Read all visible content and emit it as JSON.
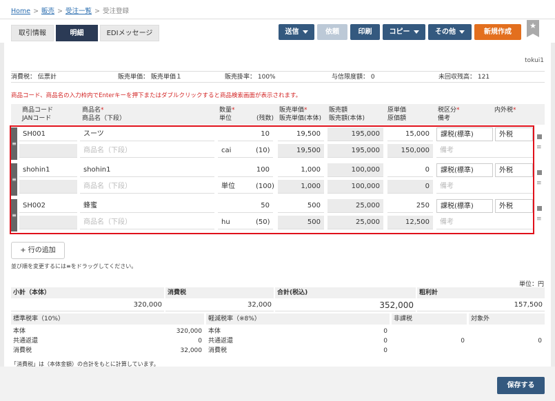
{
  "breadcrumb": {
    "home": "Home",
    "sales": "販売",
    "orders": "受注一覧",
    "current": "受注登録"
  },
  "tabs": [
    "取引情報",
    "明細",
    "EDIメッセージ"
  ],
  "toolbar": {
    "send": "送信",
    "request": "依頼",
    "print": "印刷",
    "copy": "コピー",
    "other": "その他",
    "new": "新規作成"
  },
  "user": "tokui1",
  "info": {
    "tax": "消費税： 伝票計",
    "price": "販売単価： 販売単価１",
    "rate": "販売掛率： 100%",
    "limit": "与信限度額： 0",
    "balance": "未回収残高： 121"
  },
  "notice": "商品コード、商品名の入力枠内でEnterキーを押下またはダブルクリックすると商品検索画面が表示されます。",
  "columns": {
    "code": "商品コード",
    "jan": "JANコード",
    "name": "商品名",
    "name2": "商品名（下段）",
    "qty": "数量",
    "unit": "単位",
    "rest": "(残数)",
    "price": "販売単価",
    "price2": "販売単価(本体)",
    "amount": "販売額",
    "amount2": "販売額(本体)",
    "cost": "原単価",
    "costamt": "原価額",
    "taxcat": "税区分",
    "memo": "備考",
    "taxin": "内外税"
  },
  "rows": [
    {
      "code": "SH001",
      "name": "スーツ",
      "name2_ph": "商品名（下段）",
      "qty": "10",
      "unit": "cai",
      "rest": "(10)",
      "price": "19,500",
      "price2": "19,500",
      "amount": "195,000",
      "amount2": "195,000",
      "cost": "15,000",
      "costamt": "150,000",
      "taxcat": "課税(標準)",
      "taxin": "外税",
      "memo_ph": "備考"
    },
    {
      "code": "shohin1",
      "name": "shohin1",
      "name2_ph": "商品名（下段）",
      "qty": "100",
      "unit": "単位",
      "rest": "(100)",
      "price": "1,000",
      "price2": "1,000",
      "amount": "100,000",
      "amount2": "100,000",
      "cost": "0",
      "costamt": "0",
      "taxcat": "課税(標準)",
      "taxin": "外税",
      "memo_ph": "備考"
    },
    {
      "code": "SH002",
      "name": "蜂蜜",
      "name2_ph": "商品名（下段）",
      "qty": "50",
      "unit": "hu",
      "rest": "(50)",
      "price": "500",
      "price2": "500",
      "amount": "25,000",
      "amount2": "25,000",
      "cost": "250",
      "costamt": "12,500",
      "taxcat": "課税(標準)",
      "taxin": "外税",
      "memo_ph": "備考"
    }
  ],
  "add_row": "+ 行の追加",
  "hint": "並び順を変更するには≡をドラッグしてください。",
  "unit": "単位：円",
  "totals": {
    "sub_l": "小計（本体）",
    "sub_v": "320,000",
    "tax_l": "消費税",
    "tax_v": "32,000",
    "total_l": "合計(税込)",
    "total_v": "352,000",
    "gross_l": "粗利計",
    "gross_v": "157,500"
  },
  "std": {
    "title": "標準税率（10%）",
    "body_l": "本体",
    "body_v": "320,000",
    "ret_l": "共通返還",
    "ret_v": "0",
    "tax_l": "消費税",
    "tax_v": "32,000"
  },
  "red": {
    "title": "軽減税率（※8%）",
    "body_l": "本体",
    "body_v": "0",
    "ret_l": "共通返還",
    "ret_v": "0",
    "tax_l": "消費税",
    "tax_v": "0"
  },
  "nontax": {
    "title": "非課税",
    "v": "0"
  },
  "exempt": {
    "title": "対象外",
    "v": "0"
  },
  "footnote": "「消費税」は（本体金額）の合計をもとに計算しています。",
  "save": "保存する"
}
